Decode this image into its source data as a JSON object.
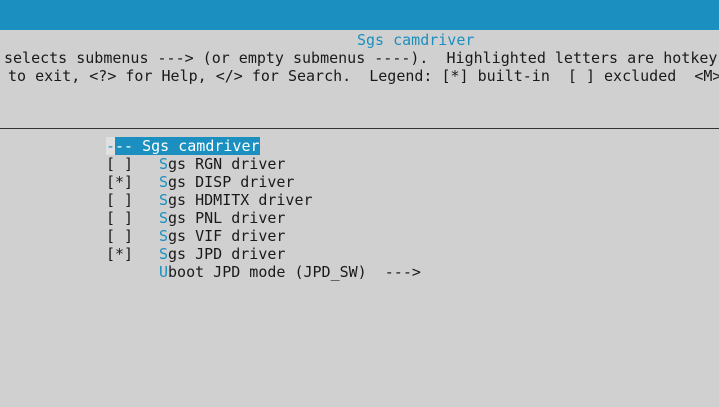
{
  "window": {
    "title": "Sgs camdriver",
    "help_line_1": "selects submenus ---> (or empty submenus ----).  Highlighted letters are hotkeys",
    "help_line_2": "to exit, <?> for Help, </> for Search.  Legend: [*] built-in  [ ] excluded  <M>"
  },
  "menu": {
    "selected": {
      "prefix": "-",
      "rest": "-- Sgs camdriver"
    },
    "items": [
      {
        "box": "[ ]",
        "hotkey": "S",
        "label": "gs RGN driver"
      },
      {
        "box": "[*]",
        "hotkey": "S",
        "label": "gs DISP driver"
      },
      {
        "box": "[ ]",
        "hotkey": "S",
        "label": "gs HDMITX driver"
      },
      {
        "box": "[ ]",
        "hotkey": "S",
        "label": "gs PNL driver"
      },
      {
        "box": "[ ]",
        "hotkey": "S",
        "label": "gs VIF driver"
      },
      {
        "box": "[*]",
        "hotkey": "S",
        "label": "gs JPD driver"
      },
      {
        "box": "",
        "hotkey": "U",
        "label": "boot JPD mode (JPD_SW)  --->"
      }
    ]
  },
  "colors": {
    "accent": "#1b8fc0",
    "dialog_bg": "#d0d0d0",
    "text": "#1a1a1a"
  }
}
